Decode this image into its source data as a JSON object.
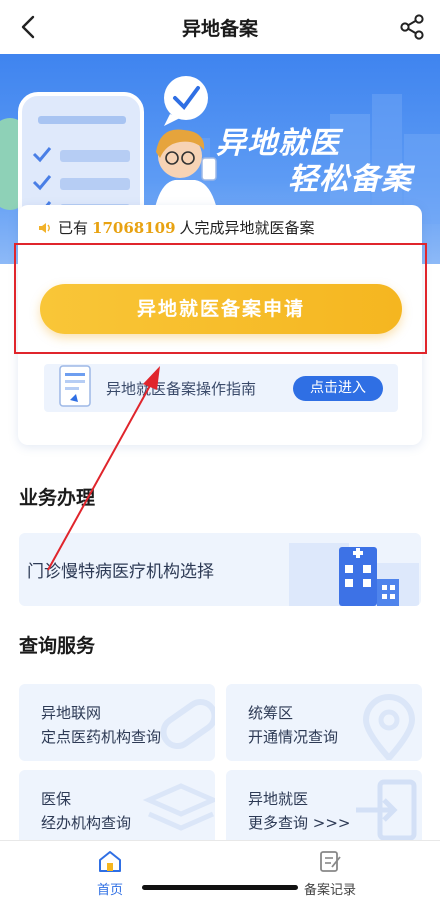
{
  "navbar": {
    "title": "异地备案",
    "back_icon": "chevron-left-icon",
    "share_icon": "share-icon"
  },
  "banner": {
    "title_line1": "异地就医",
    "title_line2": "轻松备案"
  },
  "stats": {
    "prefix": "已有",
    "count": "17068109",
    "suffix": "人完成异地就医备案"
  },
  "apply_button": {
    "label": "异地就医备案申请"
  },
  "guide": {
    "label": "异地就医备案操作指南",
    "button": "点击进入"
  },
  "business": {
    "title": "业务办理",
    "item": "门诊慢特病医疗机构选择"
  },
  "query": {
    "title": "查询服务",
    "items": [
      {
        "line1": "异地联网",
        "line2": "定点医药机构查询"
      },
      {
        "line1": "统筹区",
        "line2": "开通情况查询"
      },
      {
        "line1": "医保",
        "line2": "经办机构查询"
      },
      {
        "line1": "异地就医",
        "line2": "更多查询 >>>"
      }
    ]
  },
  "tabbar": {
    "items": [
      {
        "label": "首页",
        "icon": "home-icon",
        "active": true
      },
      {
        "label": "备案记录",
        "icon": "record-icon",
        "active": false
      }
    ]
  },
  "colors": {
    "primary": "#2f6fe4",
    "accent_yellow": "#f5b620",
    "annotation_red": "#e0252c",
    "banner_blue": "#3f84ef"
  }
}
